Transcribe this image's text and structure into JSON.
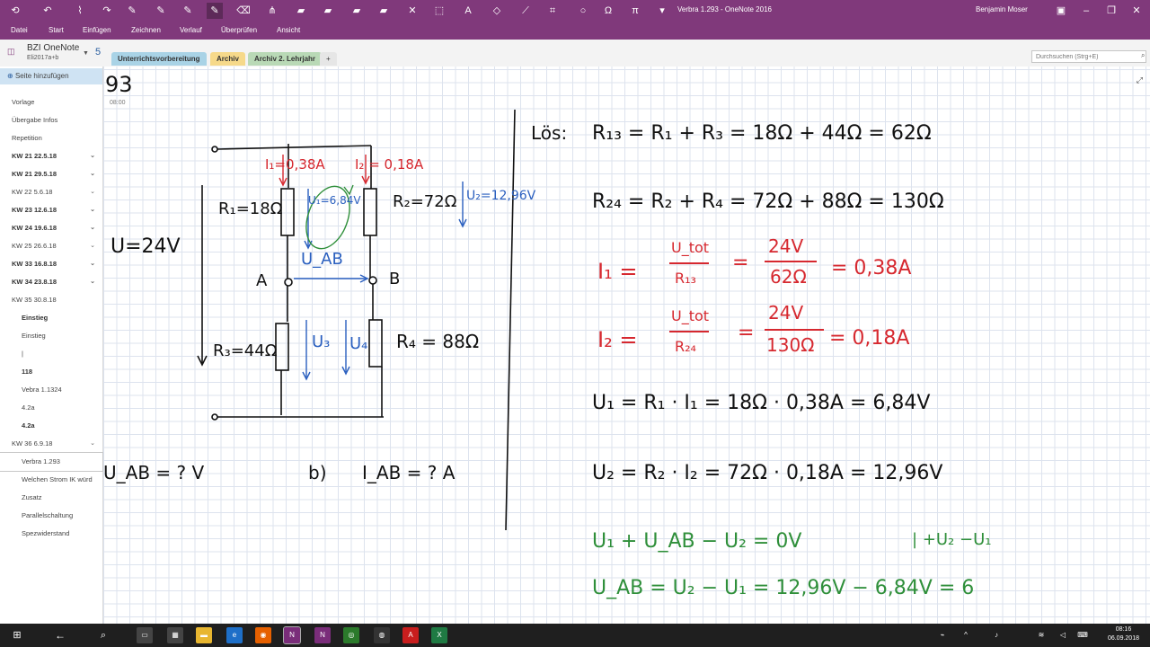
{
  "window": {
    "title": "Verbra 1.293  -  OneNote 2016",
    "user": "Benjamin Moser"
  },
  "ribbon_tabs": [
    "Datei",
    "Start",
    "Einfügen",
    "Zeichnen",
    "Verlauf",
    "Überprüfen",
    "Ansicht"
  ],
  "notebook": {
    "name": "BZI OneNote",
    "section_group": "Eli2017a+b",
    "sync_badge": "5",
    "tabs": [
      {
        "label": "Unterrichtsvorbereitung",
        "color": "#a9d3e6"
      },
      {
        "label": "Archiv",
        "color": "#f6d98a"
      },
      {
        "label": "Archiv 2. Lehrjahr",
        "color": "#b9d9b6"
      }
    ],
    "add_tab": "+",
    "search_placeholder": "Durchsuchen (Strg+E)"
  },
  "sidebar": {
    "add_page": "Seite hinzufügen",
    "pages": [
      {
        "label": "Vorlage",
        "bold": false,
        "indent": 0
      },
      {
        "label": "Übergabe Infos",
        "bold": false,
        "indent": 0
      },
      {
        "label": "Repetition",
        "bold": false,
        "indent": 0
      },
      {
        "label": "KW 21  22.5.18",
        "bold": true,
        "indent": 0,
        "chevron": true
      },
      {
        "label": "KW 21  29.5.18",
        "bold": true,
        "indent": 0,
        "chevron": true
      },
      {
        "label": "KW 22  5.6.18",
        "bold": false,
        "indent": 0,
        "chevron": true
      },
      {
        "label": "KW 23  12.6.18",
        "bold": true,
        "indent": 0,
        "chevron": true
      },
      {
        "label": "KW 24  19.6.18",
        "bold": true,
        "indent": 0,
        "chevron": true
      },
      {
        "label": "KW 25  26.6.18",
        "bold": false,
        "indent": 0,
        "chevron": true
      },
      {
        "label": "KW 33  16.8.18",
        "bold": true,
        "indent": 0,
        "chevron": true
      },
      {
        "label": "KW 34  23.8.18",
        "bold": true,
        "indent": 0,
        "chevron": true
      },
      {
        "label": "KW 35  30.8.18",
        "bold": false,
        "indent": 0
      },
      {
        "label": "Einstieg",
        "bold": true,
        "indent": 1
      },
      {
        "label": "Einstieg",
        "bold": false,
        "indent": 1
      },
      {
        "label": "|",
        "bold": false,
        "indent": 1
      },
      {
        "label": "118",
        "bold": true,
        "indent": 1
      },
      {
        "label": "Vebra 1.1324",
        "bold": false,
        "indent": 1
      },
      {
        "label": "4.2a",
        "bold": false,
        "indent": 1
      },
      {
        "label": "4.2a",
        "bold": true,
        "indent": 1
      },
      {
        "label": "KW 36  6.9.18",
        "bold": false,
        "indent": 0,
        "chevron": true
      },
      {
        "label": "Verbra 1.293",
        "bold": false,
        "indent": 1,
        "selected": true
      },
      {
        "label": "Welchen Strom IK würd",
        "bold": false,
        "indent": 1
      },
      {
        "label": "Zusatz",
        "bold": false,
        "indent": 1
      },
      {
        "label": "Parallelschaltung",
        "bold": false,
        "indent": 1
      },
      {
        "label": "Spezwiderstand",
        "bold": false,
        "indent": 1
      }
    ]
  },
  "page": {
    "title_fragment": "93",
    "time": "08:00"
  },
  "ink": {
    "voltage": "U=24V",
    "r1": "R₁=18Ω",
    "r2": "R₂=72Ω",
    "r3": "R₃=44Ω",
    "r4": "R₄ = 88Ω",
    "i1": "I₁=0,38A",
    "i2": "I₂ = 0,18A",
    "u1": "U₁=6,84V",
    "u2": "U₂=12,96V",
    "u3": "U₃",
    "u4": "U₄",
    "uab": "U_AB",
    "node_a": "A",
    "node_b": "B",
    "q_a": "U_AB = ? V",
    "q_b_label": "b)",
    "q_b": "I_AB = ? A",
    "los": "Lös:",
    "eq1": "R₁₃ = R₁ + R₃ = 18Ω + 44Ω = 62Ω",
    "eq2": "R₂₄ = R₂ + R₄ = 72Ω + 88Ω = 130Ω",
    "eq3_lhs": "I₁ =",
    "eq3_num1": "U_tot",
    "eq3_den1": "R₁₃",
    "eq3_num2": "24V",
    "eq3_den2": "62Ω",
    "eq3_res": "= 0,38A",
    "eq4_lhs": "I₂ =",
    "eq4_num1": "U_tot",
    "eq4_den1": "R₂₄",
    "eq4_num2": "24V",
    "eq4_den2": "130Ω",
    "eq4_res": "= 0,18A",
    "eq5": "U₁ = R₁ · I₁ = 18Ω · 0,38A = 6,84V",
    "eq6": "U₂ = R₂ · I₂ = 72Ω · 0,18A = 12,96V",
    "eq7": "U₁ + U_AB − U₂ = 0V",
    "eq7b": "| +U₂ −U₁",
    "eq8": "U_AB = U₂ − U₁ = 12,96V − 6,84V = 6"
  },
  "taskbar": {
    "time": "08:16",
    "date": "06.09.2018"
  },
  "colors": {
    "onenote_purple": "#80397b",
    "ink_black": "#111111",
    "ink_red": "#d6282f",
    "ink_blue": "#2a5fbf",
    "ink_green": "#2f8f3a"
  }
}
